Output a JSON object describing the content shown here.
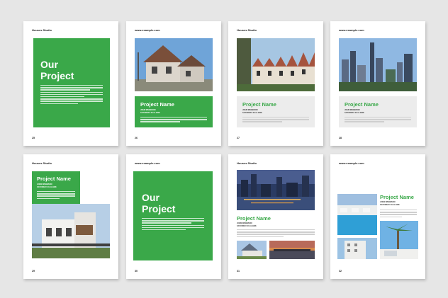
{
  "brand": "Houses Studio",
  "site": "www.example.com",
  "cover_title_line1": "Our",
  "cover_title_line2": "Project",
  "project_name": "Project Name",
  "author": "JOHN WEBBSON",
  "date": "SATURDAY 20.11.1908",
  "page_numbers": [
    "25",
    "26",
    "27",
    "28",
    "29",
    "30",
    "31",
    "32"
  ],
  "colors": {
    "accent": "#3aa849",
    "background": "#e6e6e6",
    "panel": "#ececec"
  }
}
